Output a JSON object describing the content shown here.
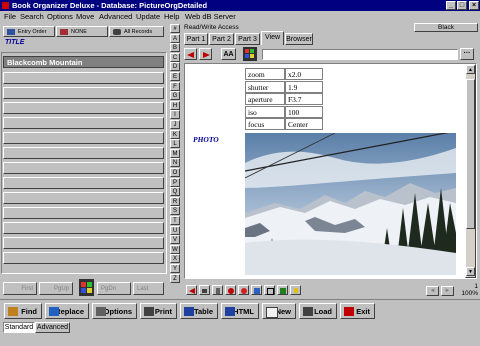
{
  "window": {
    "title": "Book Organizer Deluxe - Database: PictureOrgDetailed"
  },
  "menu": [
    "File",
    "Search",
    "Options",
    "Move",
    "Advanced",
    "Update",
    "Help",
    "Web dB Server"
  ],
  "left_toolbar": {
    "entry_order": "Entry Order",
    "none": "NONE",
    "all_records": "All Records"
  },
  "field_name": "TITLE",
  "records": [
    "Blackcomb Mountain"
  ],
  "letters": [
    "#",
    "A",
    "B",
    "C",
    "D",
    "E",
    "F",
    "G",
    "H",
    "I",
    "J",
    "K",
    "L",
    "M",
    "N",
    "O",
    "P",
    "Q",
    "R",
    "S",
    "T",
    "U",
    "V",
    "W",
    "X",
    "Y",
    "Z"
  ],
  "left_nav": {
    "first": "First",
    "pgup": "PgUp",
    "pgdn": "PgDn",
    "last": "Last"
  },
  "access": "Read/Write Access",
  "layout_name": "Black",
  "tabs": [
    "Part 1",
    "Part 2",
    "Part 3",
    "View",
    "Browser"
  ],
  "active_tab": "View",
  "exif": [
    {
      "label": "zoom",
      "value": "x2.0"
    },
    {
      "label": "shutter",
      "value": "1.9"
    },
    {
      "label": "aperture",
      "value": "F3.7"
    },
    {
      "label": "iso",
      "value": "100"
    },
    {
      "label": "focus",
      "value": "Center"
    }
  ],
  "photo_label": "PHOTO",
  "counter": {
    "record": "1",
    "zoom": "100%"
  },
  "buttons": [
    "Find",
    "Replace",
    "Options",
    "Print",
    "Table",
    "HTML",
    "New",
    "Load",
    "Exit"
  ],
  "mode_tabs": [
    "Standard",
    "Advanced"
  ],
  "colors": {
    "titlebar": "#000080",
    "field_label": "#000099",
    "selected_row": "#808080"
  }
}
